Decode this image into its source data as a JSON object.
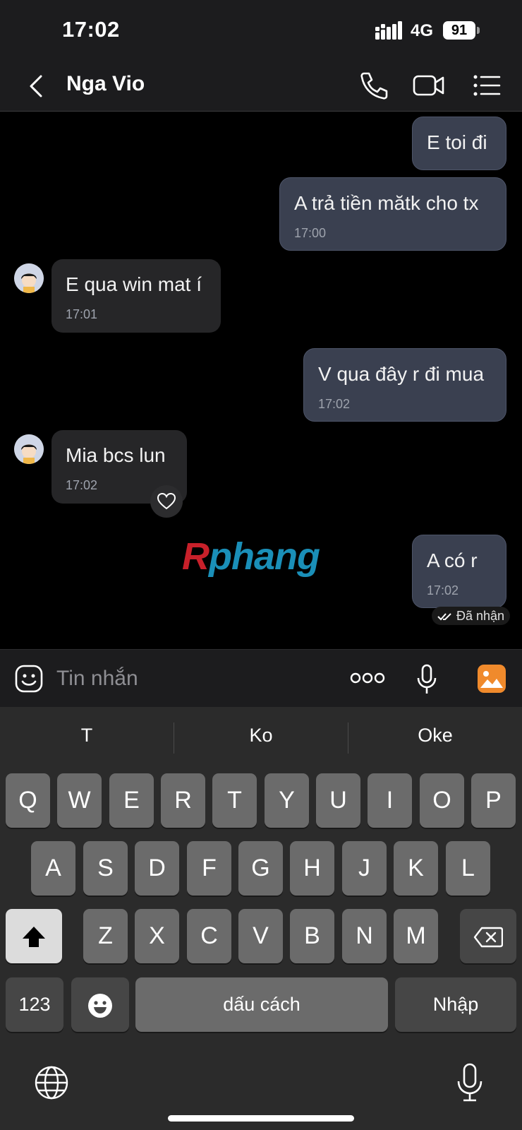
{
  "status_bar": {
    "time": "17:02",
    "network": "4G",
    "battery": "91"
  },
  "header": {
    "contact_name": "Nga Vio",
    "icons": [
      "back-icon",
      "phone-icon",
      "video-icon",
      "menu-icon"
    ]
  },
  "messages": [
    {
      "direction": "out",
      "text": "E toi đi",
      "time": ""
    },
    {
      "direction": "out",
      "text": "A trả tiền mătk cho tx",
      "time": "17:00"
    },
    {
      "direction": "in",
      "text": "E qua win mat í",
      "time": "17:01"
    },
    {
      "direction": "out",
      "text": "V qua đây r đi mua",
      "time": "17:02"
    },
    {
      "direction": "in",
      "text": "Mia bcs lun",
      "time": "17:02"
    },
    {
      "direction": "out",
      "text": "A có r",
      "time": "17:02"
    }
  ],
  "watermark": {
    "first": "R",
    "rest": "phang"
  },
  "delivered_status": "Đã nhận",
  "composer": {
    "placeholder": "Tin nhắn",
    "icons": [
      "sticker-icon",
      "more-icon",
      "microphone-icon",
      "image-icon"
    ]
  },
  "keyboard": {
    "suggestions": [
      "T",
      "Ko",
      "Oke"
    ],
    "row1": [
      "Q",
      "W",
      "E",
      "R",
      "T",
      "Y",
      "U",
      "I",
      "O",
      "P"
    ],
    "row2": [
      "A",
      "S",
      "D",
      "F",
      "G",
      "H",
      "J",
      "K",
      "L"
    ],
    "row3": [
      "Z",
      "X",
      "C",
      "V",
      "B",
      "N",
      "M"
    ],
    "numbers_label": "123",
    "space_label": "dấu cách",
    "return_label": "Nhập"
  },
  "colors": {
    "accent_orange": "#f08a2c",
    "outgoing_bubble": "#3a4050",
    "incoming_bubble": "#262628"
  }
}
